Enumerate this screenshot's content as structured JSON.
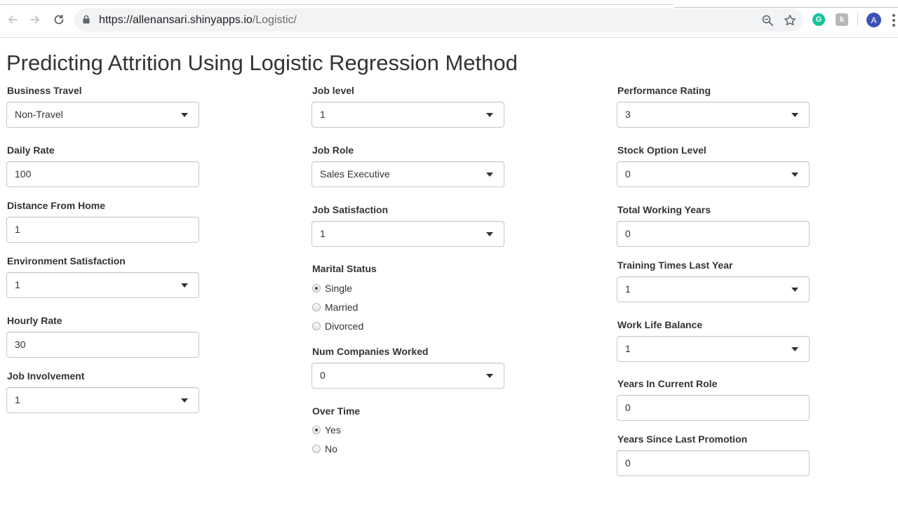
{
  "browser": {
    "url_host": "https://allenansari.shinyapps.io",
    "url_path": "/Logistic/",
    "profile_initial": "A",
    "icons": [
      "back-arrow-icon",
      "forward-arrow-icon",
      "reload-icon",
      "lock-icon",
      "zoom-icon",
      "star-icon",
      "grammarly-extension-icon",
      "extension-icon",
      "profile-avatar",
      "menu-icon"
    ]
  },
  "page": {
    "title": "Predicting Attrition Using Logistic Regression Method"
  },
  "column1": {
    "business_travel": {
      "label": "Business Travel",
      "value": "Non-Travel"
    },
    "daily_rate": {
      "label": "Daily Rate",
      "value": "100"
    },
    "distance_from_home": {
      "label": "Distance From Home",
      "value": "1"
    },
    "environment_satisfaction": {
      "label": "Environment Satisfaction",
      "value": "1"
    },
    "hourly_rate": {
      "label": "Hourly Rate",
      "value": "30"
    },
    "job_involvement": {
      "label": "Job Involvement",
      "value": "1"
    }
  },
  "column2": {
    "job_level": {
      "label": "Job level",
      "value": "1"
    },
    "job_role": {
      "label": "Job Role",
      "value": "Sales Executive"
    },
    "job_satisfaction": {
      "label": "Job Satisfaction",
      "value": "1"
    },
    "marital_status": {
      "label": "Marital Status",
      "options": [
        "Single",
        "Married",
        "Divorced"
      ],
      "selected": "Single"
    },
    "num_companies_worked": {
      "label": "Num Companies Worked",
      "value": "0"
    },
    "over_time": {
      "label": "Over Time",
      "options": [
        "Yes",
        "No"
      ],
      "selected": "Yes"
    }
  },
  "column3": {
    "performance_rating": {
      "label": "Performance Rating",
      "value": "3"
    },
    "stock_option_level": {
      "label": "Stock Option Level",
      "value": "0"
    },
    "total_working_years": {
      "label": "Total Working Years",
      "value": "0"
    },
    "training_times_last_year": {
      "label": "Training Times Last Year",
      "value": "1"
    },
    "work_life_balance": {
      "label": "Work Life Balance",
      "value": "1"
    },
    "years_in_current_role": {
      "label": "Years In Current Role",
      "value": "0"
    },
    "years_since_last_promotion": {
      "label": "Years Since Last Promotion",
      "value": "0"
    }
  },
  "colors": {
    "grammarly": "#15c39a",
    "avatar": "#3f51b5",
    "input_border": "#c8c8c8"
  }
}
